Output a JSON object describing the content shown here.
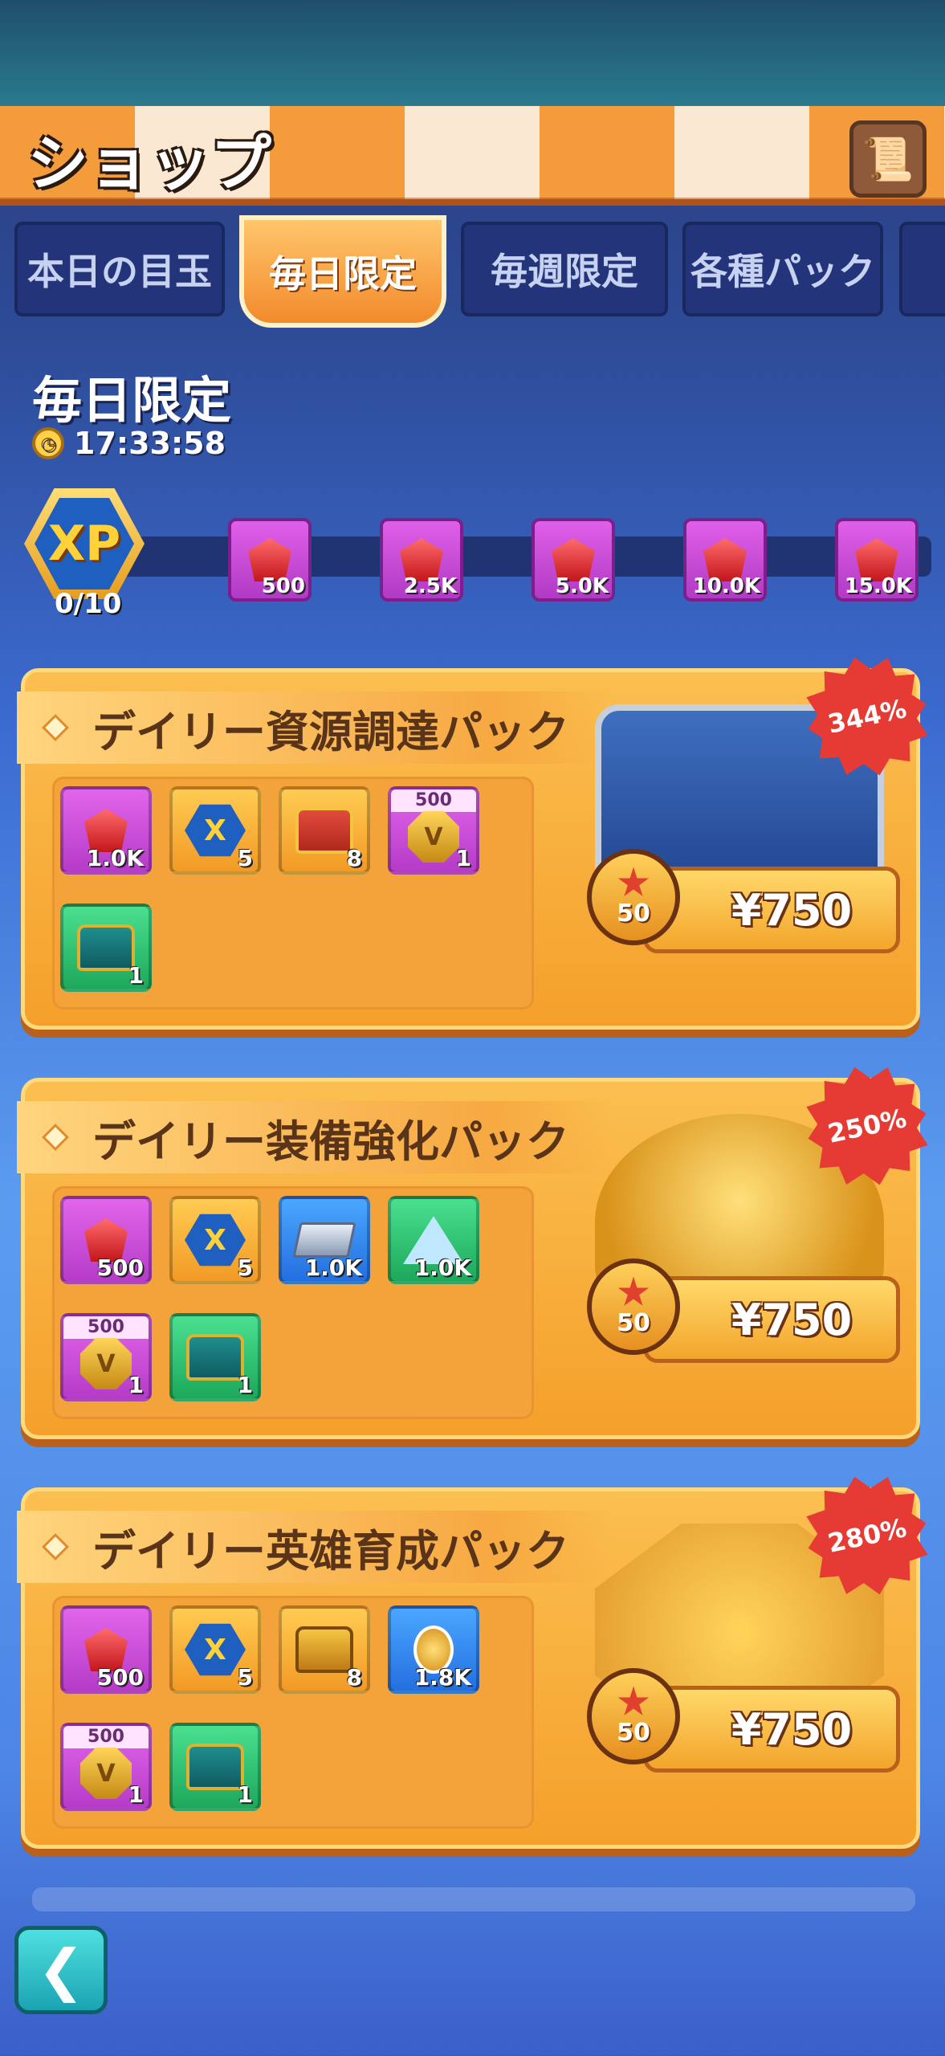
{
  "header": {
    "title": "ショップ",
    "scroll_icon": "scroll-icon"
  },
  "tabs": [
    {
      "label": "本日の目玉"
    },
    {
      "label": "毎日限定"
    },
    {
      "label": "毎週限定"
    },
    {
      "label": "各種パック"
    }
  ],
  "section": {
    "title": "毎日限定",
    "timer": "17:33:58"
  },
  "progress": {
    "count": "0/10",
    "badge_text": "XP",
    "milestones": [
      {
        "label": "500"
      },
      {
        "label": "2.5K"
      },
      {
        "label": "5.0K"
      },
      {
        "label": "10.0K"
      },
      {
        "label": "15.0K"
      }
    ]
  },
  "packs": [
    {
      "title": "デイリー資源調達パック",
      "discount": "344%",
      "points": "50",
      "price": "¥750",
      "art": "blue-chest",
      "items": [
        {
          "icon": "gem-icon",
          "qty": "1.0K",
          "bg": "purple"
        },
        {
          "icon": "xp-icon",
          "qty": "5",
          "bg": "orange"
        },
        {
          "icon": "red-chest-icon",
          "qty": "8",
          "bg": "orange"
        },
        {
          "icon": "medal-icon",
          "qty": "1",
          "bg": "purple",
          "top": "500"
        },
        {
          "icon": "teal-chest-icon",
          "qty": "1",
          "bg": "green"
        }
      ]
    },
    {
      "title": "デイリー装備強化パック",
      "discount": "250%",
      "points": "50",
      "price": "¥750",
      "art": "golden-armor",
      "items": [
        {
          "icon": "gem-icon",
          "qty": "500",
          "bg": "purple"
        },
        {
          "icon": "xp-icon",
          "qty": "5",
          "bg": "orange"
        },
        {
          "icon": "iron-ingot-icon",
          "qty": "1.0K",
          "bg": "blue"
        },
        {
          "icon": "crystal-icon",
          "qty": "1.0K",
          "bg": "green"
        },
        {
          "icon": "medal-icon",
          "qty": "1",
          "bg": "purple",
          "top": "500"
        },
        {
          "icon": "teal-chest-icon",
          "qty": "1",
          "bg": "green"
        }
      ]
    },
    {
      "title": "デイリー英雄育成パック",
      "discount": "280%",
      "points": "50",
      "price": "¥750",
      "art": "golden-medal",
      "items": [
        {
          "icon": "gem-icon",
          "qty": "500",
          "bg": "purple"
        },
        {
          "icon": "xp-icon",
          "qty": "5",
          "bg": "orange"
        },
        {
          "icon": "gold-chest-icon",
          "qty": "8",
          "bg": "orange"
        },
        {
          "icon": "hero-medal-icon",
          "qty": "1.8K",
          "bg": "blue"
        },
        {
          "icon": "medal-icon",
          "qty": "1",
          "bg": "purple",
          "top": "500"
        },
        {
          "icon": "teal-chest-icon",
          "qty": "1",
          "bg": "green"
        }
      ]
    }
  ],
  "nav": {
    "back_icon": "back-arrow-icon"
  }
}
